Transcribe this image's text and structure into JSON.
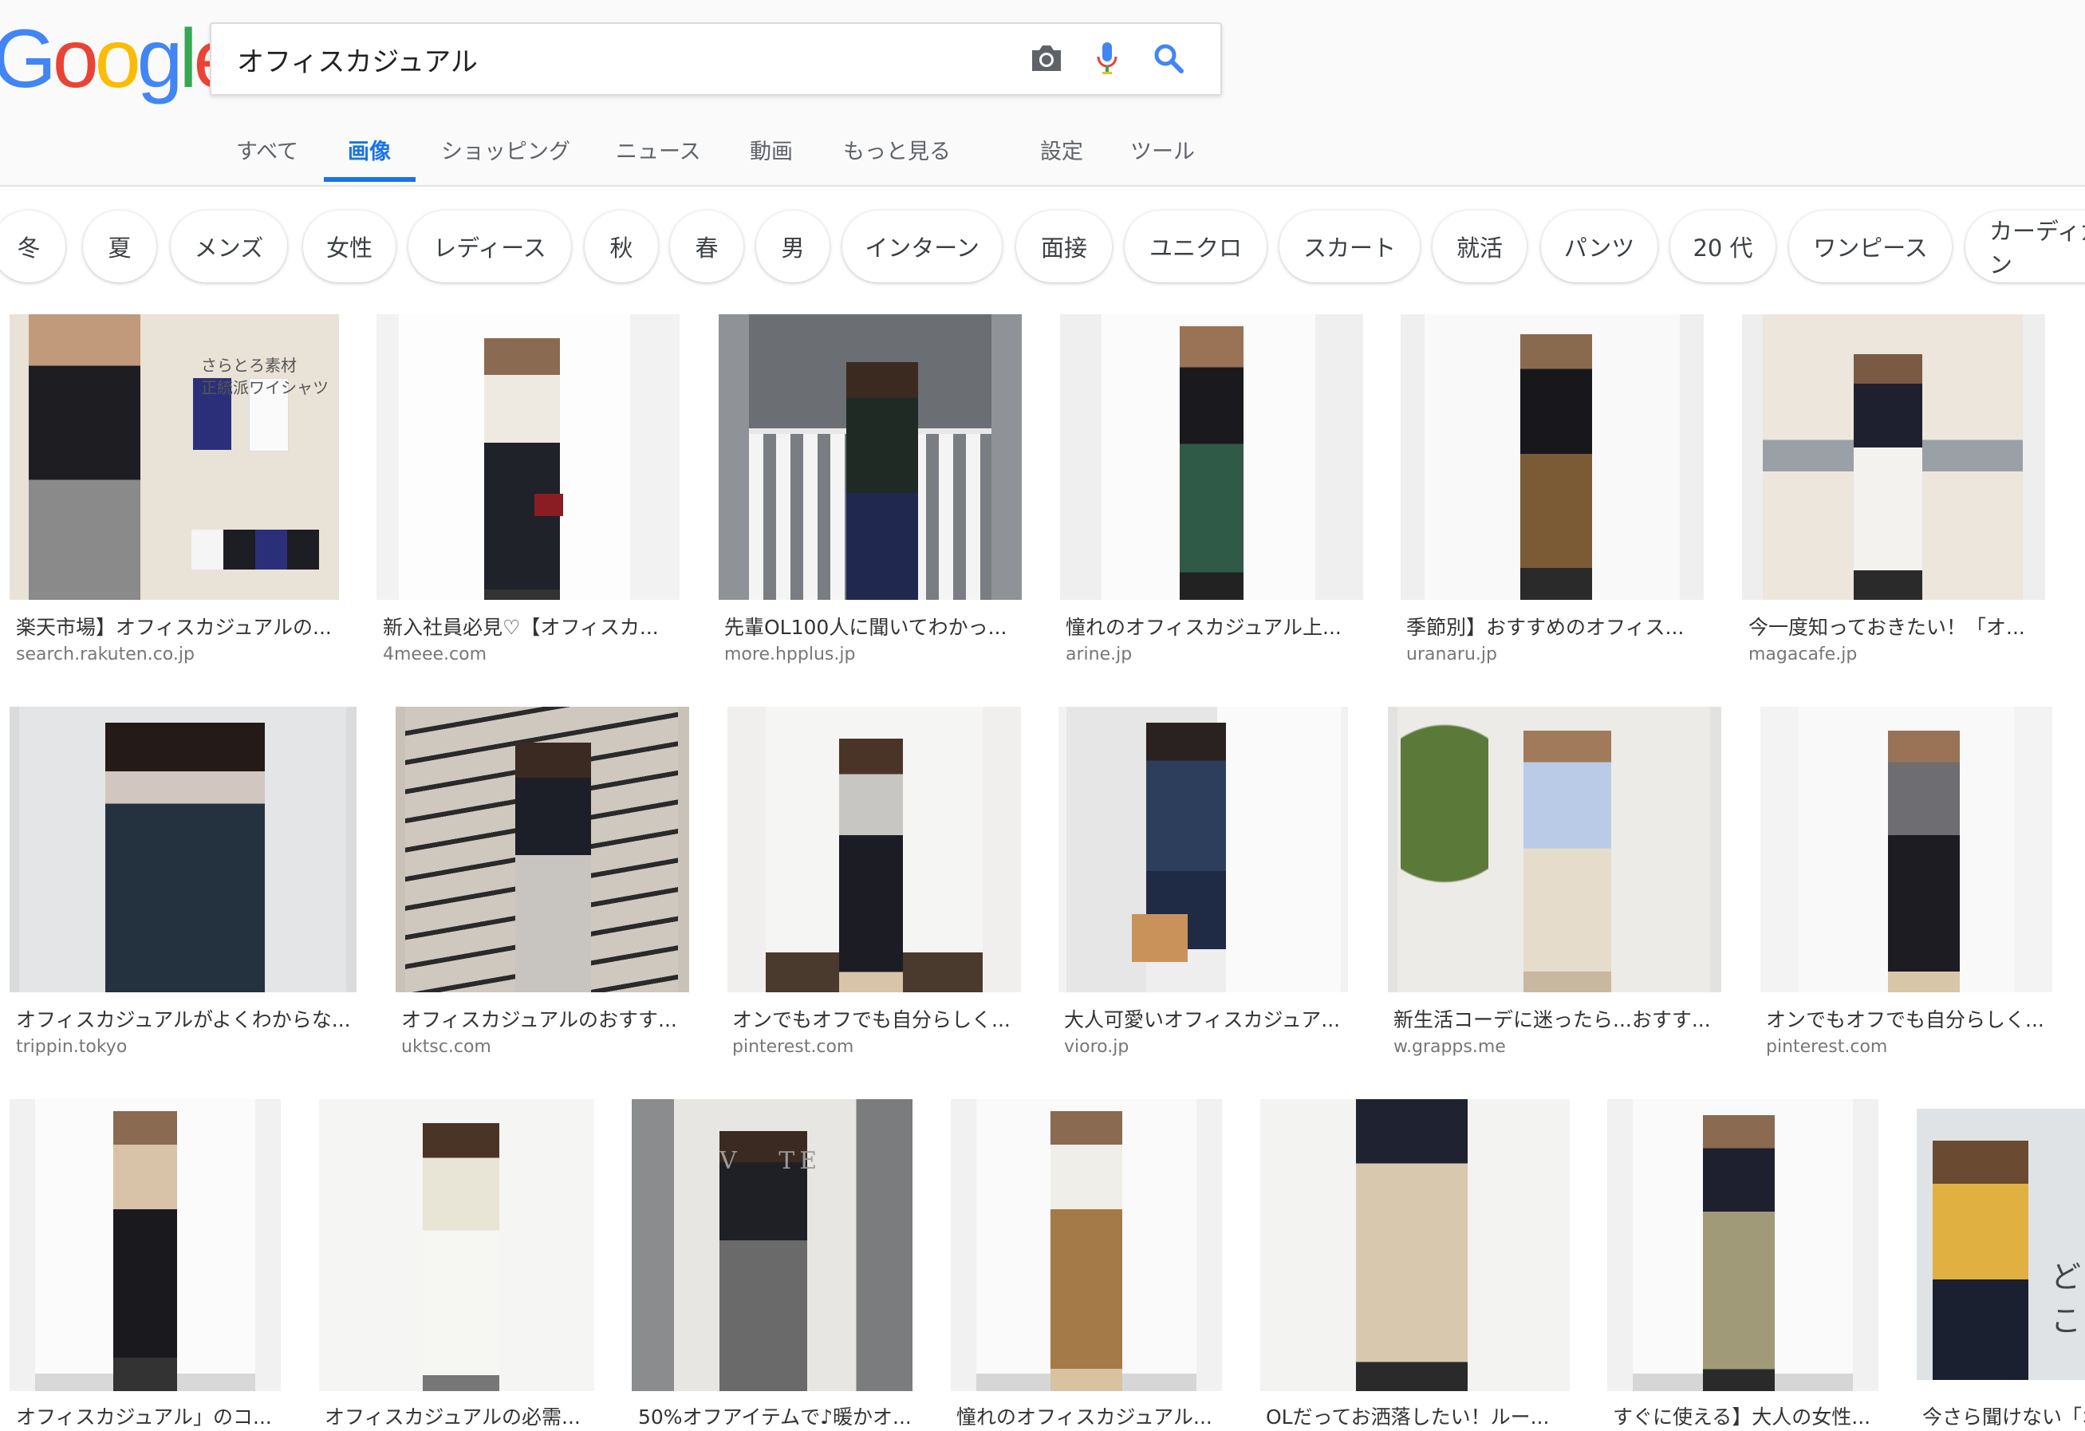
{
  "search": {
    "query": "オフィスカジュアル"
  },
  "logo": [
    "G",
    "o",
    "o",
    "g",
    "l",
    "e"
  ],
  "tabs": [
    "すべて",
    "画像",
    "ショッピング",
    "ニュース",
    "動画",
    "もっと見る",
    "設定",
    "ツール"
  ],
  "chips": [
    "冬",
    "夏",
    "メンズ",
    "女性",
    "レディース",
    "秋",
    "春",
    "男",
    "インターン",
    "面接",
    "ユニクロ",
    "スカート",
    "就活",
    "パンツ",
    "20 代",
    "ワンピース",
    "カーディガン"
  ],
  "results": [
    {
      "title": "楽天市場】オフィスカジュアルの...",
      "domain": "search.rakuten.co.jp",
      "overlay": "さらとろ素材\n正統派ワイシャツ"
    },
    {
      "title": "新入社員必見♡【オフィスカ...",
      "domain": "4meee.com"
    },
    {
      "title": "先輩OL100人に聞いてわかっ...",
      "domain": "more.hpplus.jp"
    },
    {
      "title": "憧れのオフィスカジュアル上...",
      "domain": "arine.jp"
    },
    {
      "title": "季節別】おすすめのオフィス...",
      "domain": "uranaru.jp"
    },
    {
      "title": "今一度知っておきたい！「オ...",
      "domain": "magacafe.jp"
    },
    {
      "title": "オフィスカジュアルがよくわからな...",
      "domain": "trippin.tokyo"
    },
    {
      "title": "オフィスカジュアルのおすす...",
      "domain": "uktsc.com"
    },
    {
      "title": "オンでもオフでも自分らしく...",
      "domain": "pinterest.com"
    },
    {
      "title": "大人可愛いオフィスカジュア...",
      "domain": "vioro.jp"
    },
    {
      "title": "新生活コーデに迷ったら...おすす...",
      "domain": "w.grapps.me"
    },
    {
      "title": "オンでもオフでも自分らしく...",
      "domain": "pinterest.com"
    },
    {
      "title": "オフィスカジュアル」のコ...",
      "domain": ""
    },
    {
      "title": "オフィスカジュアルの必需...",
      "domain": ""
    },
    {
      "title": "50%オフアイテムで♪暖かオ...",
      "domain": "",
      "overlay": "V   TE"
    },
    {
      "title": "憧れのオフィスカジュアル...",
      "domain": ""
    },
    {
      "title": "OLだってお洒落したい！ルー...",
      "domain": ""
    },
    {
      "title": "すぐに使える】大人の女性...",
      "domain": ""
    },
    {
      "title": "今さら聞けない「オ",
      "domain": "",
      "overlay": "どこ"
    }
  ],
  "colors": {
    "accent": "#1a73e8",
    "logo": [
      "#4285f4",
      "#ea4335",
      "#fbbc05",
      "#4285f4",
      "#34a853",
      "#ea4335"
    ]
  }
}
